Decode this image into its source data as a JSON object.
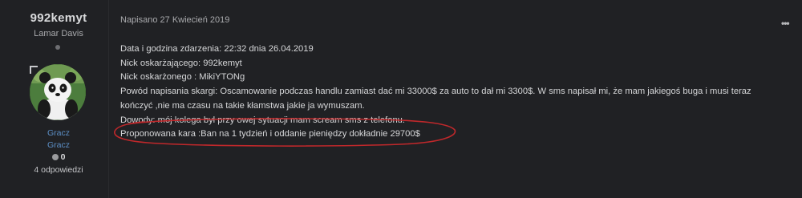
{
  "author": {
    "username": "992kemyt",
    "title": "Lamar Davis",
    "groups": [
      "Gracz",
      "Gracz"
    ],
    "reputation": "0",
    "answers": "4 odpowiedzi"
  },
  "post": {
    "date_label": "Napisano 27 Kwiecień 2019",
    "menu_icon": "more-dots-icon",
    "lines": [
      "Data i godzina zdarzenia: 22:32 dnia 26.04.2019",
      "Nick oskarżającego: 992kemyt",
      "Nick oskarżonego : MikiYTONg",
      "Powód napisania skargi: Oscamowanie podczas handlu zamiast dać mi 33000$ za auto to dał mi 3300$. W sms napisał mi, że mam jakiegoś buga i musi teraz",
      "kończyć ,nie ma czasu na takie kłamstwa jakie ja wymuszam.",
      "Dowody: mój kolega był przy owej sytuacji mam scream sms z telefonu.",
      "Proponowana kara :Ban na 1 tydzień i oddanie pieniędzy dokładnie 29700$"
    ]
  },
  "colors": {
    "background": "#202124",
    "text": "#d6d7d9",
    "group_link": "#5c8fc6",
    "highlight_ellipse": "#c0282b"
  }
}
